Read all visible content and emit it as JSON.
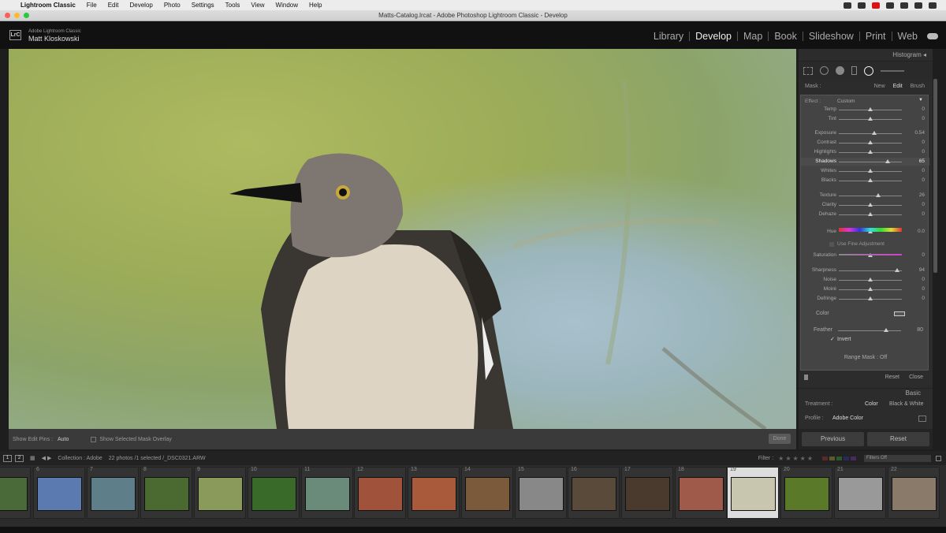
{
  "menubar": {
    "app": "Lightroom Classic",
    "items": [
      "File",
      "Edit",
      "Develop",
      "Photo",
      "Settings",
      "Tools",
      "View",
      "Window",
      "Help"
    ]
  },
  "window": {
    "title": "Matts-Catalog.lrcat - Adobe Photoshop Lightroom Classic - Develop"
  },
  "identity": {
    "badge": "LrC",
    "app": "Adobe Lightroom Classic",
    "user": "Matt Kloskowski"
  },
  "modules": [
    "Library",
    "Develop",
    "Map",
    "Book",
    "Slideshow",
    "Print",
    "Web"
  ],
  "active_module": "Develop",
  "panel": {
    "histogram_label": "Histogram",
    "mask_label": "Mask :",
    "mask_options": [
      "New",
      "Edit",
      "Brush"
    ],
    "effect_label": "Effect :",
    "effect_value": "Custom",
    "sliders": [
      {
        "label": "Temp",
        "value": "0",
        "pos": 0.5
      },
      {
        "label": "Tint",
        "value": "0",
        "pos": 0.5
      },
      {
        "label": "Exposure",
        "value": "0.54",
        "pos": 0.56
      },
      {
        "label": "Contrast",
        "value": "0",
        "pos": 0.5
      },
      {
        "label": "Highlights",
        "value": "0",
        "pos": 0.5
      },
      {
        "label": "Shadows",
        "value": "65",
        "pos": 0.78
      },
      {
        "label": "Whites",
        "value": "0",
        "pos": 0.5
      },
      {
        "label": "Blacks",
        "value": "0",
        "pos": 0.5
      },
      {
        "label": "Texture",
        "value": "26",
        "pos": 0.62
      },
      {
        "label": "Clarity",
        "value": "0",
        "pos": 0.5
      },
      {
        "label": "Dehaze",
        "value": "0",
        "pos": 0.5
      },
      {
        "label": "Hue",
        "value": "0.0",
        "pos": 0.5
      },
      {
        "label": "Saturation",
        "value": "0",
        "pos": 0.5
      },
      {
        "label": "Sharpness",
        "value": "94",
        "pos": 0.92
      },
      {
        "label": "Noise",
        "value": "0",
        "pos": 0.5
      },
      {
        "label": "Moiré",
        "value": "0",
        "pos": 0.5
      },
      {
        "label": "Defringe",
        "value": "0",
        "pos": 0.5
      }
    ],
    "fine_adjust": "Use Fine Adjustment",
    "color_label": "Color",
    "feather_label": "Feather",
    "feather_value": "80",
    "invert_label": "Invert",
    "range_mask": "Range Mask : Off",
    "reset": "Reset",
    "close": "Close",
    "basic": "Basic",
    "treatment_label": "Treatment :",
    "treatment_options": [
      "Color",
      "Black & White"
    ],
    "profile_label": "Profile :",
    "profile_value": "Adobe Color",
    "previous": "Previous",
    "reset_btn": "Reset"
  },
  "toolbar": {
    "edit_pins_label": "Show Edit Pins :",
    "edit_pins_value": "Auto",
    "overlay_label": "Show Selected Mask Overlay",
    "done": "Done"
  },
  "filmstrip_bar": {
    "pages": [
      "1",
      "2"
    ],
    "collection": "Collection : Adobe",
    "count": "22 photos /1 selected /_DSC0321.ARW",
    "filter_label": "Filter :",
    "filters_off": "Filters Off"
  },
  "filmstrip": [
    {
      "num": "",
      "color": "#4a6a3a",
      "sel": false
    },
    {
      "num": "6",
      "color": "#5a7ab0",
      "sel": false
    },
    {
      "num": "7",
      "color": "#5e7e8a",
      "sel": false
    },
    {
      "num": "8",
      "color": "#4a6a32",
      "sel": false
    },
    {
      "num": "9",
      "color": "#8a9a5a",
      "sel": false
    },
    {
      "num": "10",
      "color": "#3a6a2a",
      "sel": false
    },
    {
      "num": "11",
      "color": "#6a8a7a",
      "sel": false
    },
    {
      "num": "12",
      "color": "#a0523a",
      "sel": false
    },
    {
      "num": "13",
      "color": "#a85a3a",
      "sel": false
    },
    {
      "num": "14",
      "color": "#7a5a3a",
      "sel": false
    },
    {
      "num": "15",
      "color": "#888",
      "sel": false
    },
    {
      "num": "16",
      "color": "#5a4a3a",
      "sel": false
    },
    {
      "num": "17",
      "color": "#4a3a2e",
      "sel": false
    },
    {
      "num": "18",
      "color": "#a05a4a",
      "sel": false
    },
    {
      "num": "19",
      "color": "#c9c6b0",
      "sel": true
    },
    {
      "num": "20",
      "color": "#5a7a2a",
      "sel": false
    },
    {
      "num": "21",
      "color": "#999",
      "sel": false
    },
    {
      "num": "22",
      "color": "#8a7a6a",
      "sel": false
    }
  ]
}
